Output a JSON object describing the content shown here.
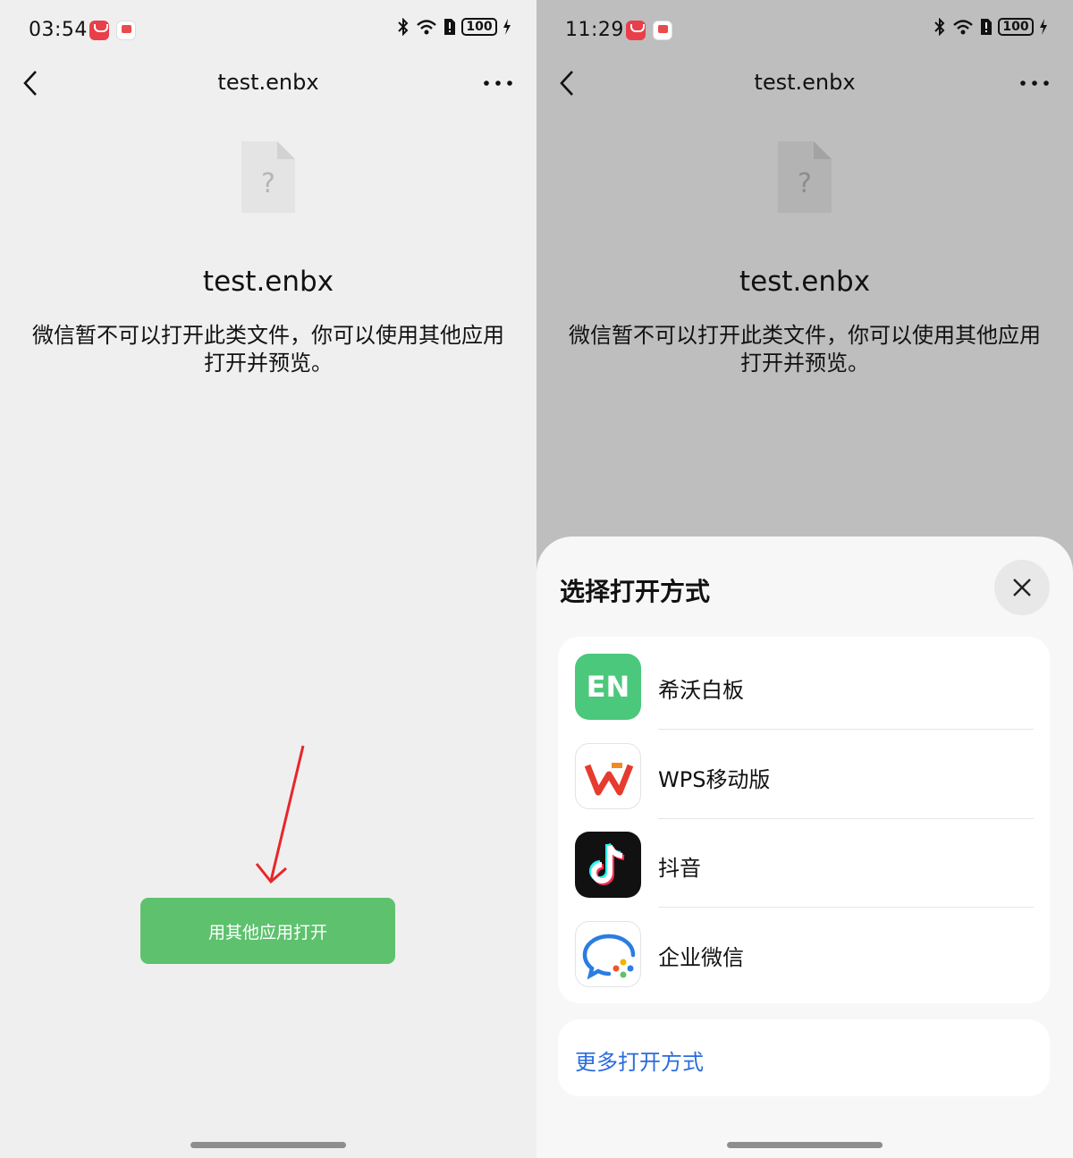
{
  "left_screen": {
    "status": {
      "time": "03:54",
      "battery": "100"
    },
    "nav": {
      "title": "test.enbx"
    },
    "file": {
      "icon_glyph": "?",
      "name": "test.enbx",
      "description": "微信暂不可以打开此类文件，你可以使用其他应用打开并预览。"
    },
    "open_other_button": "用其他应用打开",
    "annotation_color": "#e8262a",
    "accent_color": "#5ec16e"
  },
  "right_screen": {
    "status": {
      "time": "11:29",
      "battery": "100"
    },
    "nav": {
      "title": "test.enbx"
    },
    "file": {
      "icon_glyph": "?",
      "name": "test.enbx",
      "description": "微信暂不可以打开此类文件，你可以使用其他应用打开并预览。"
    },
    "sheet": {
      "title": "选择打开方式",
      "apps": [
        {
          "name": "希沃白板",
          "icon": "easinote-icon",
          "icon_text": "EN"
        },
        {
          "name": "WPS移动版",
          "icon": "wps-icon"
        },
        {
          "name": "抖音",
          "icon": "douyin-icon"
        },
        {
          "name": "企业微信",
          "icon": "wecom-icon"
        }
      ],
      "more_options": "更多打开方式",
      "link_color": "#2a6cdc"
    }
  }
}
